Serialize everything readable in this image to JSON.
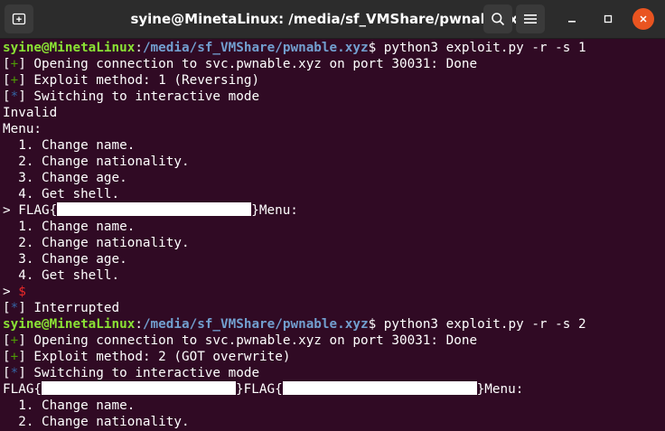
{
  "window": {
    "title": "syine@MinetaLinux: /media/sf_VMShare/pwnable.xyz",
    "new_tab_icon": "new-tab-icon",
    "search_icon": "search-icon",
    "menu_icon": "hamburger-menu-icon",
    "minimize_icon": "minimize-icon",
    "maximize_icon": "maximize-icon",
    "close_icon": "close-icon"
  },
  "colors": {
    "background": "#300a24",
    "titlebar": "#2c2c2c",
    "prompt_user": "#8ae234",
    "prompt_path": "#729fcf",
    "plus_marker": "#4e9a06",
    "star_marker": "#3465a4",
    "red_prompt": "#ef2929",
    "close_button": "#e95420"
  },
  "prompt": {
    "user": "syine@MinetaLinux",
    "colon": ":",
    "path": "/media/sf_VMShare/pwnable.xyz",
    "dollar": "$"
  },
  "run1": {
    "command": " python3 exploit.py -r -s 1",
    "open": " Opening connection to svc.pwnable.xyz on port 30031: Done",
    "method": " Exploit method: 1 (Reversing)",
    "interactive": " Switching to interactive mode",
    "invalid": "Invalid",
    "menu_header": "Menu:",
    "menu1": [
      "  1. Change name.",
      "  2. Change nationality.",
      "  3. Change age.",
      "  4. Get shell."
    ],
    "flag_prefix": "> FLAG{",
    "flag_suffix": "}Menu:",
    "menu2": [
      "  1. Change name.",
      "  2. Change nationality.",
      "  3. Change age.",
      "  4. Get shell."
    ],
    "prompt_arrow": "> ",
    "prompt_dollar": "$",
    "interrupted": " Interrupted"
  },
  "run2": {
    "command": " python3 exploit.py -r -s 2",
    "open": " Opening connection to svc.pwnable.xyz on port 30031: Done",
    "method": " Exploit method: 2 (GOT overwrite)",
    "interactive": " Switching to interactive mode",
    "flag_prefix": "FLAG{",
    "flag_middle": "}FLAG{",
    "flag_suffix": "}Menu:",
    "menu": [
      "  1. Change name.",
      "  2. Change nationality."
    ]
  },
  "markers": {
    "open_bracket": "[",
    "close_bracket": "]",
    "plus": "+",
    "star": "*"
  }
}
